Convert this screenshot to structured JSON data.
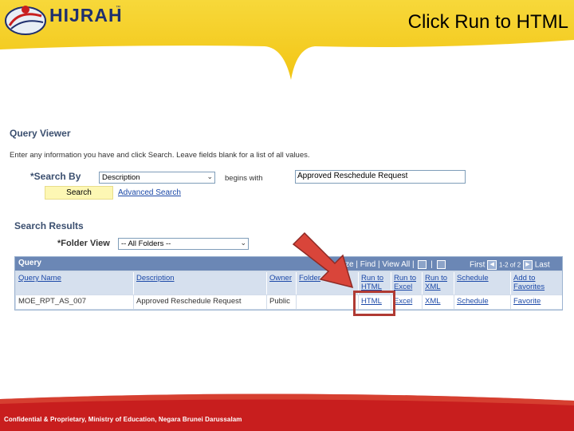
{
  "slide": {
    "title": "Click Run to HTML",
    "logo_text": "HIJRAH",
    "logo_tm": "™",
    "footer": "Confidential & Proprietary, Ministry of Education, Negara Brunei Darussalam",
    "colors": {
      "band_yellow": "#f5d21a",
      "band_red": "#c81e1e",
      "highlight": "#b03a33"
    }
  },
  "query_viewer": {
    "title": "Query Viewer",
    "instructions": "Enter any information you have and click Search. Leave fields blank for a list of all values.",
    "search_by_label": "*Search By",
    "search_by_value": "Description",
    "begins_with": "begins with",
    "search_text": "Approved Reschedule Request",
    "search_button": "Search",
    "advanced_search": "Advanced Search"
  },
  "search_results": {
    "title": "Search Results",
    "folder_view_label": "*Folder View",
    "folder_view_value": "-- All Folders --",
    "grid_title": "Query",
    "tools": {
      "customize": "ze",
      "find": "Find",
      "view_all": "View All"
    },
    "nav": {
      "first": "First",
      "count": "1-2 of 2",
      "last": "Last"
    },
    "columns": {
      "query_name": "Query Name",
      "description": "Description",
      "owner": "Owner",
      "folder": "Folder",
      "run_html": [
        "Run to",
        "HTML"
      ],
      "run_excel": [
        "Run to",
        "Excel"
      ],
      "run_xml": [
        "Run to",
        "XML"
      ],
      "schedule": "Schedule",
      "add_favorites": [
        "Add to",
        "Favorites"
      ]
    },
    "rows": [
      {
        "query_name": "MOE_RPT_AS_007",
        "description": "Approved Reschedule Request",
        "owner": "Public",
        "folder": "",
        "html": "HTML",
        "excel": "Excel",
        "xml": "XML",
        "schedule": "Schedule",
        "favorite": "Favorite"
      }
    ]
  }
}
